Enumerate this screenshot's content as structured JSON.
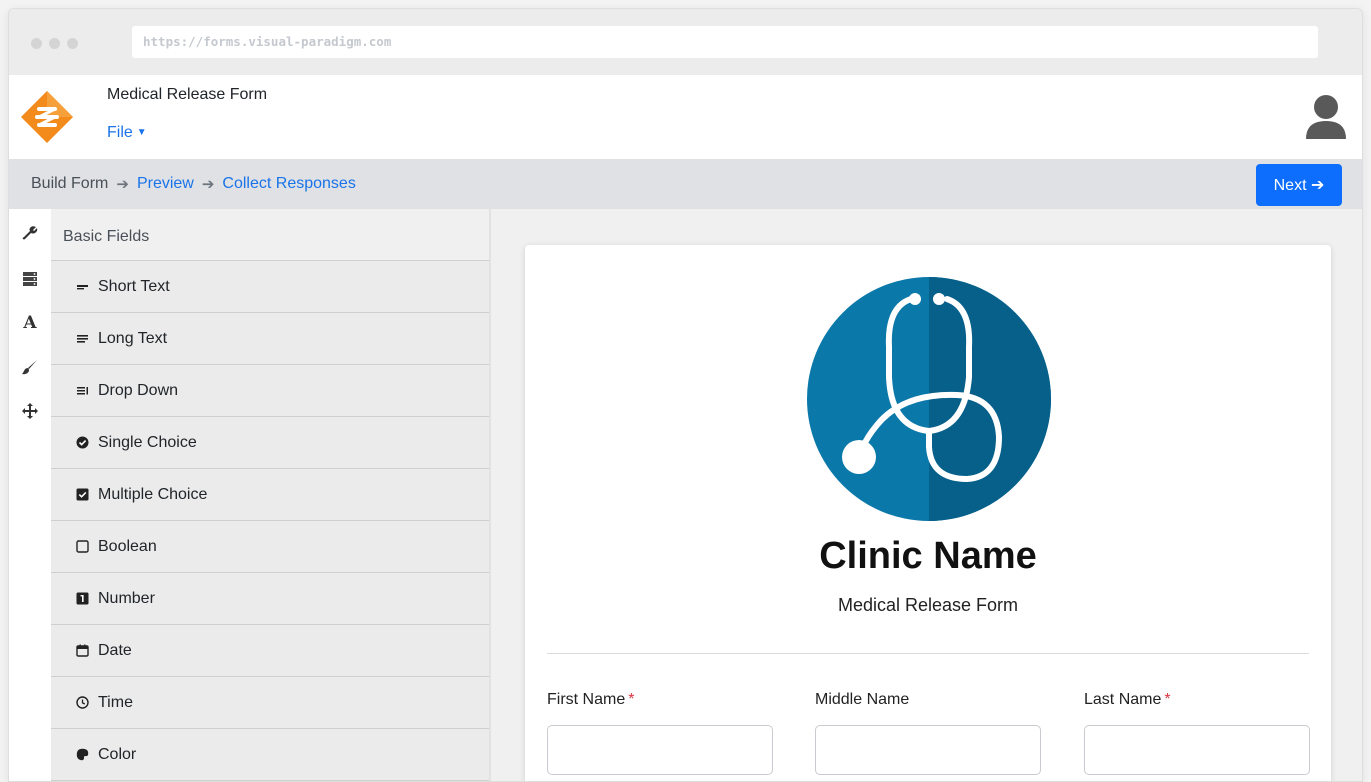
{
  "browser": {
    "url": "https://forms.visual-paradigm.com"
  },
  "app": {
    "form_title": "Medical Release Form",
    "file_menu_label": "File"
  },
  "steps": {
    "current": "Build Form",
    "preview": "Preview",
    "collect": "Collect Responses",
    "next_label": "Next"
  },
  "tools": [
    {
      "icon": "wrench-icon"
    },
    {
      "icon": "fields-icon"
    },
    {
      "icon": "font-icon"
    },
    {
      "icon": "brush-icon"
    },
    {
      "icon": "move-icon"
    }
  ],
  "fields_panel": {
    "header": "Basic Fields",
    "items": [
      {
        "label": "Short Text",
        "icon": "short-text-icon"
      },
      {
        "label": "Long Text",
        "icon": "long-text-icon"
      },
      {
        "label": "Drop Down",
        "icon": "dropdown-icon"
      },
      {
        "label": "Single Choice",
        "icon": "check-circle-icon"
      },
      {
        "label": "Multiple Choice",
        "icon": "check-square-icon"
      },
      {
        "label": "Boolean",
        "icon": "square-icon"
      },
      {
        "label": "Number",
        "icon": "number-icon"
      },
      {
        "label": "Date",
        "icon": "calendar-icon"
      },
      {
        "label": "Time",
        "icon": "clock-icon"
      },
      {
        "label": "Color",
        "icon": "palette-icon"
      }
    ]
  },
  "form": {
    "clinic_name": "Clinic Name",
    "subtitle": "Medical Release Form",
    "fields": [
      {
        "label": "First Name",
        "required": true,
        "value": ""
      },
      {
        "label": "Middle Name",
        "required": false,
        "value": ""
      },
      {
        "label": "Last Name",
        "required": true,
        "value": ""
      }
    ]
  },
  "colors": {
    "accent": "#1a73e8",
    "primary_button": "#0d6efd",
    "logo_orange": "#f28a1c",
    "clinic_blue": "#0a78a8",
    "clinic_blue_dark": "#07608a",
    "required": "#dc3545"
  }
}
